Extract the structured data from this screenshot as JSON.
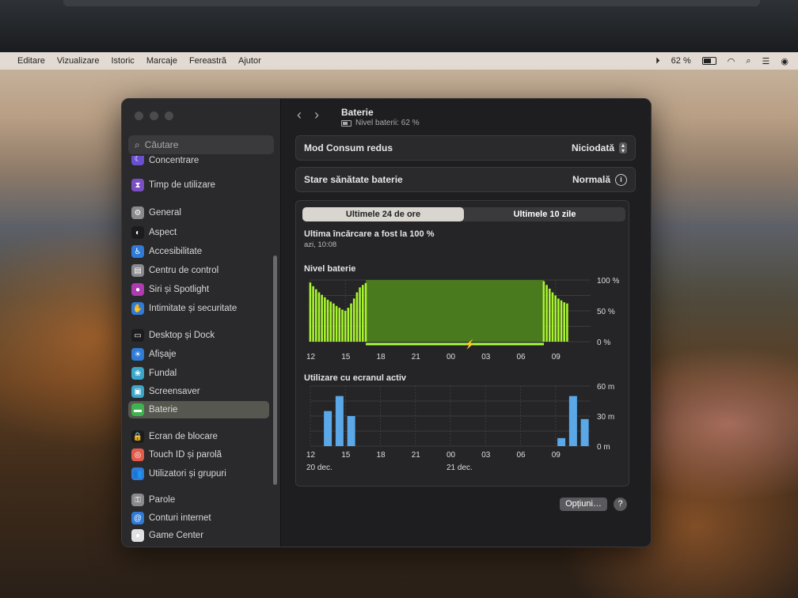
{
  "menubar": {
    "items": [
      "Editare",
      "Vizualizare",
      "Istoric",
      "Marcaje",
      "Fereastră",
      "Ajutor"
    ],
    "battery_percent": "62 %"
  },
  "sidebar": {
    "search_placeholder": "Căutare",
    "items": [
      {
        "label": "Concentrare",
        "icon": "moon-icon",
        "color": "#6a4fd1"
      },
      {
        "label": "Timp de utilizare",
        "icon": "hourglass-icon",
        "color": "#7a4fc4"
      },
      {
        "label": "General",
        "icon": "gear-icon",
        "color": "#8a8a8e"
      },
      {
        "label": "Aspect",
        "icon": "appearance-icon",
        "color": "#1c1c1e"
      },
      {
        "label": "Accesibilitate",
        "icon": "accessibility-icon",
        "color": "#2f7bd6"
      },
      {
        "label": "Centru de control",
        "icon": "control-center-icon",
        "color": "#8a8a8e"
      },
      {
        "label": "Siri și Spotlight",
        "icon": "siri-icon",
        "color": "#b03ab0"
      },
      {
        "label": "Intimitate și securitate",
        "icon": "hand-icon",
        "color": "#2f7bd6"
      },
      {
        "label": "Desktop și Dock",
        "icon": "dock-icon",
        "color": "#1c1c1e"
      },
      {
        "label": "Afișaje",
        "icon": "display-icon",
        "color": "#2f7bd6"
      },
      {
        "label": "Fundal",
        "icon": "wallpaper-icon",
        "color": "#3aa6c9"
      },
      {
        "label": "Screensaver",
        "icon": "screensaver-icon",
        "color": "#3aa6c9"
      },
      {
        "label": "Baterie",
        "icon": "battery-icon",
        "color": "#3fb34f"
      },
      {
        "label": "Ecran de blocare",
        "icon": "lock-icon",
        "color": "#1c1c1e"
      },
      {
        "label": "Touch ID și parolă",
        "icon": "fingerprint-icon",
        "color": "#e35a4a"
      },
      {
        "label": "Utilizatori și grupuri",
        "icon": "users-icon",
        "color": "#2f7bd6"
      },
      {
        "label": "Parole",
        "icon": "key-icon",
        "color": "#8a8a8e"
      },
      {
        "label": "Conturi internet",
        "icon": "at-icon",
        "color": "#2f7bd6"
      },
      {
        "label": "Game Center",
        "icon": "game-center-icon",
        "color": "#e0e0e0"
      }
    ]
  },
  "header": {
    "title": "Baterie",
    "subtitle": "Nivel baterii: 62 %"
  },
  "rows": {
    "low_power_label": "Mod Consum redus",
    "low_power_value": "Niciodată",
    "health_label": "Stare sănătate baterie",
    "health_value": "Normală"
  },
  "tabs": {
    "day": "Ultimele 24 de ore",
    "ten_days": "Ultimele 10 zile"
  },
  "last_charge": {
    "text": "Ultima încărcare a fost la 100 %",
    "time": "azi, 10:08"
  },
  "footer": {
    "options_button": "Opțiuni…",
    "help_button": "?"
  },
  "chart_data": [
    {
      "type": "bar",
      "title": "Nivel baterie",
      "categories": [
        "12:00",
        "12:15",
        "12:30",
        "12:45",
        "13:00",
        "13:15",
        "13:30",
        "13:45",
        "14:00",
        "14:15",
        "14:30",
        "14:45",
        "15:00",
        "15:15",
        "15:30",
        "15:45",
        "16:00",
        "16:15",
        "16:30",
        "16:45",
        "08:00",
        "08:15",
        "08:30",
        "08:45",
        "09:00",
        "09:15",
        "09:30",
        "09:45",
        "10:00"
      ],
      "values": [
        96,
        90,
        85,
        80,
        76,
        72,
        68,
        65,
        62,
        58,
        55,
        52,
        50,
        55,
        62,
        70,
        80,
        88,
        92,
        95,
        98,
        92,
        86,
        80,
        75,
        70,
        67,
        64,
        62
      ],
      "charging_period": {
        "from": "16:45",
        "to": "08:00",
        "level": 100
      },
      "x_tick_labels": [
        "12",
        "15",
        "18",
        "21",
        "00",
        "03",
        "06",
        "09"
      ],
      "y_tick_labels": [
        "100 %",
        "50 %",
        "0 %"
      ],
      "ylim": [
        0,
        100
      ]
    },
    {
      "type": "bar",
      "title": "Utilizare cu ecranul activ",
      "categories": [
        "13",
        "14",
        "15",
        "09",
        "10",
        "11"
      ],
      "values": [
        35,
        50,
        30,
        8,
        50,
        27
      ],
      "x_tick_labels": [
        "12",
        "15",
        "18",
        "21",
        "00",
        "03",
        "06",
        "09"
      ],
      "y_tick_labels": [
        "60 m",
        "30 m",
        "0 m"
      ],
      "date_labels": [
        "20 dec.",
        "21 dec."
      ],
      "ylim": [
        0,
        60
      ]
    }
  ]
}
